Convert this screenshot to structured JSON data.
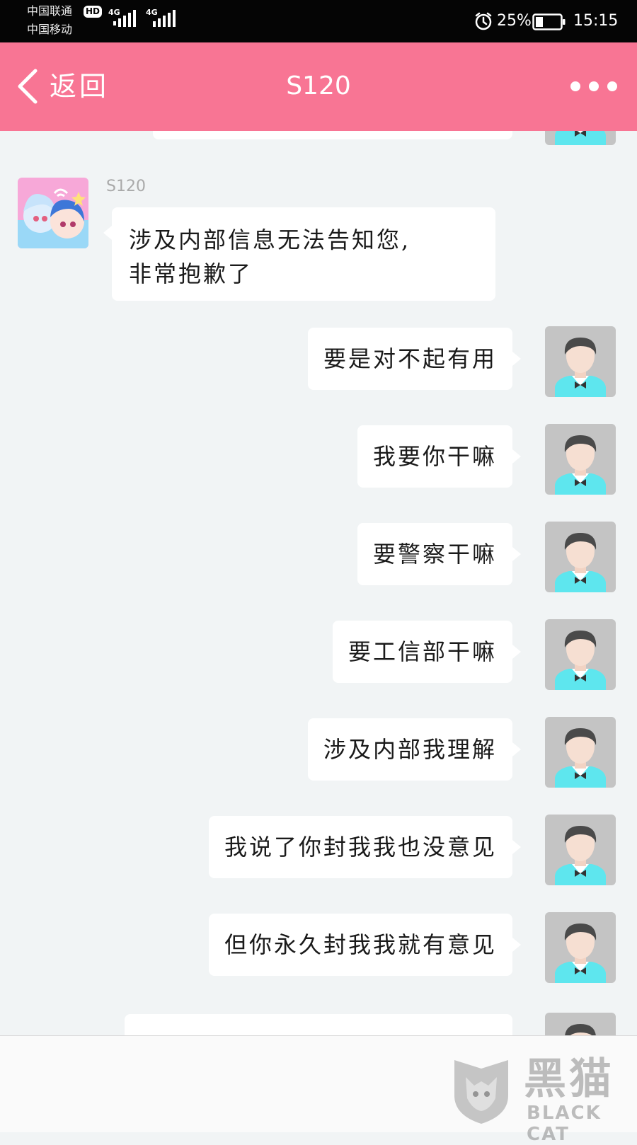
{
  "status_bar": {
    "carrier_1": "中国联通",
    "carrier_2": "中国移动",
    "hd": "HD",
    "net_1": "4G",
    "net_2": "4G",
    "battery": "25%",
    "time": "15:15",
    "icons": [
      "signal-icon",
      "alarm-icon",
      "battery-icon"
    ]
  },
  "header": {
    "back_label": "返回",
    "title": "S120",
    "icons": [
      "back-chevron-icon",
      "more-icon"
    ]
  },
  "chat": {
    "contact_name": "S120",
    "incoming": {
      "lines": [
        "涉及内部信息无法告知您,",
        "非常抱歉了"
      ]
    },
    "outgoing": [
      "要是对不起有用",
      "我要你干嘛",
      "要警察干嘛",
      "要工信部干嘛",
      "涉及内部我理解",
      "我说了你封我我也没意见",
      "但你永久封我我就有意见"
    ]
  },
  "watermark": {
    "text": "黑猫",
    "sub": "BLACK CAT"
  },
  "colors": {
    "header_bg": "#f87594",
    "status_bg": "#050505",
    "chat_bg": "#f1f4f5",
    "bubble_bg": "#ffffff",
    "avatar_shirt": "#5ee6ee"
  }
}
